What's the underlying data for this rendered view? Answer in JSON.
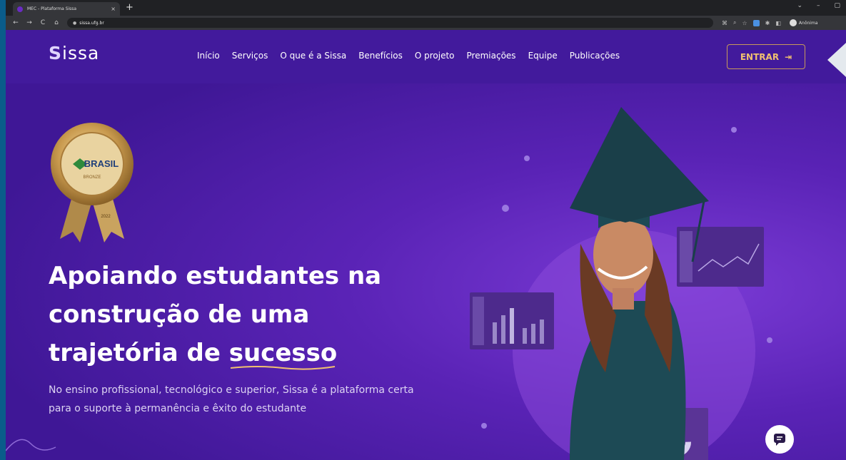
{
  "browser": {
    "tab_title": "MEC - Plataforma Sissa",
    "tab_close": "×",
    "new_tab": "+",
    "window_controls": [
      "⌄",
      "–",
      "▢"
    ],
    "url": "sissa.ufg.br",
    "nav_buttons": [
      "←",
      "→",
      "C",
      "⌂"
    ],
    "toolbar_icons": [
      "⌘",
      "⌕",
      "☆"
    ],
    "profile_label": "Anônima"
  },
  "header": {
    "logo": "issa",
    "logo_mark": "S",
    "nav": [
      "Início",
      "Serviços",
      "O que é a Sissa",
      "Benefícios",
      "O projeto",
      "Premiações",
      "Equipe",
      "Publicações"
    ],
    "login_label": "ENTRAR",
    "login_icon": "⇥"
  },
  "badge": {
    "country": "BRASIL",
    "level": "BRONZE",
    "year": "2022"
  },
  "hero": {
    "title_line1": "Apoiando estudantes na",
    "title_line2": "construção de uma",
    "title_line3_prefix": "trajetória de ",
    "title_highlight": "sucesso",
    "subtitle": "No ensino profissional, tecnológico e superior, Sissa é a plataforma certa para o suporte à permanência e êxito do estudante"
  },
  "colors": {
    "page_bg": "#4b1ca6",
    "header_bg": "#421a9c",
    "accent_gold": "#f0c070",
    "text_light": "#dcd3f2"
  },
  "icons": {
    "chat": "chat-icon",
    "login": "login-icon"
  }
}
